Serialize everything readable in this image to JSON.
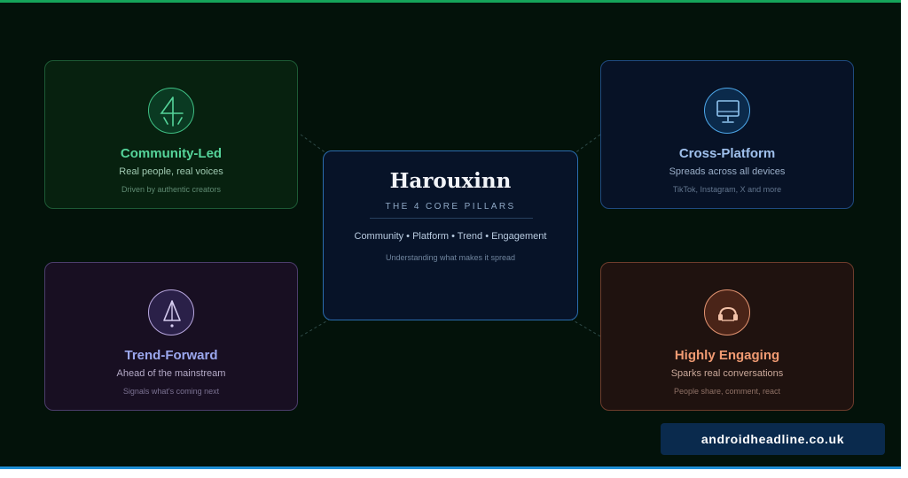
{
  "center": {
    "brand": "Harouxinn",
    "tagline": "THE 4 CORE PILLARS",
    "pillars": "Community • Platform • Trend • Engagement",
    "caption": "Understanding what makes it spread"
  },
  "cards": {
    "community": {
      "icon": "abstract-figure-icon",
      "title": "Community-Led",
      "subtitle": "Real people, real voices",
      "note": "Driven by authentic creators",
      "accent": "#55d49a"
    },
    "platform": {
      "icon": "monitor-icon",
      "title": "Cross-Platform",
      "subtitle": "Spreads across all devices",
      "note": "TikTok, Instagram, X and more",
      "accent": "#4da6e8"
    },
    "trend": {
      "icon": "warning-triangle-icon",
      "title": "Trend-Forward",
      "subtitle": "Ahead of the mainstream",
      "note": "Signals what's coming next",
      "accent": "#9ba7ee"
    },
    "engagement": {
      "icon": "chat-bubbles-icon",
      "title": "Highly Engaging",
      "subtitle": "Sparks real conversations",
      "note": "People share, comment, react",
      "accent": "#f09a72"
    }
  },
  "source": {
    "label": "androidheadline.co.uk"
  }
}
